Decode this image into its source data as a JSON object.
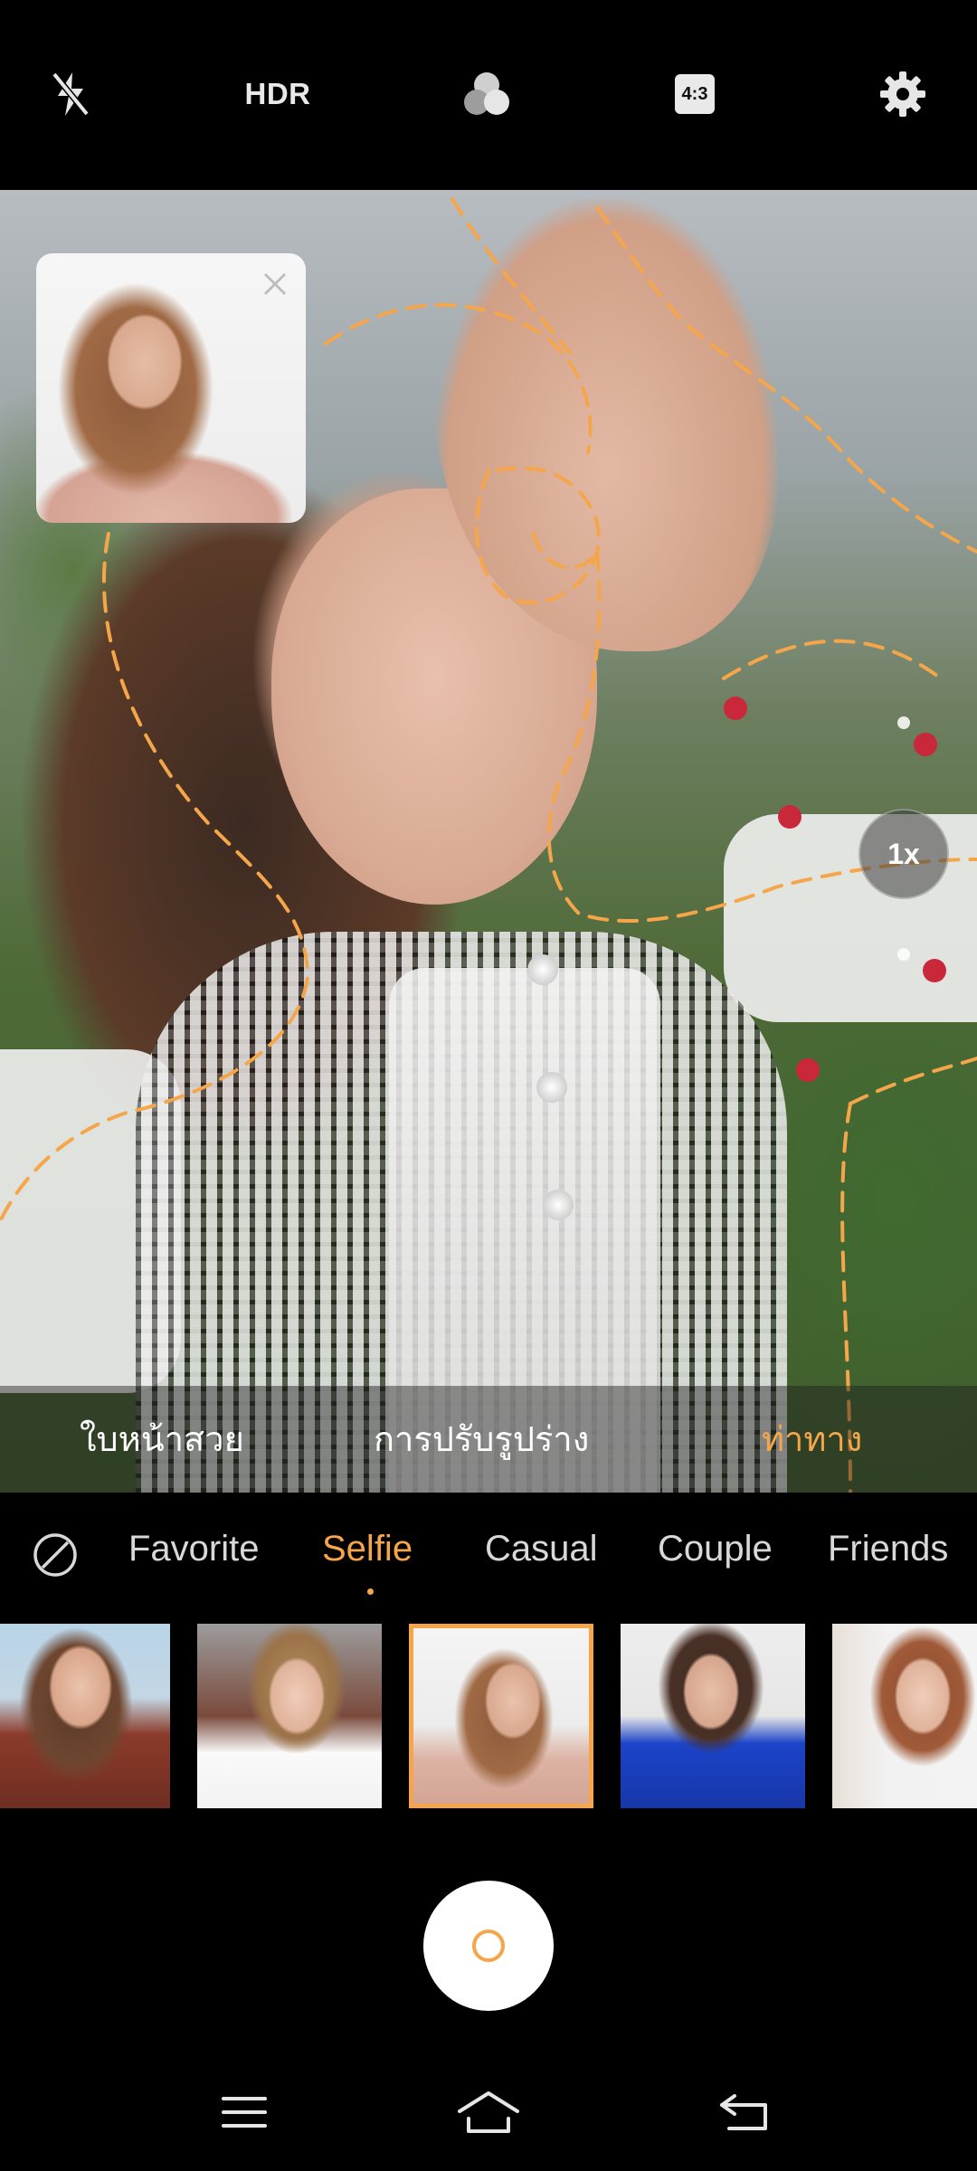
{
  "toolbar": {
    "flash_icon": "flash-off-icon",
    "hdr_label": "HDR",
    "filter_icon": "filters-icon",
    "ratio_label": "4:3",
    "settings_icon": "gear-icon"
  },
  "viewfinder": {
    "zoom_label": "1x",
    "pose_reference_close_icon": "close-icon",
    "options": [
      {
        "label": "ใบหน้าสวย",
        "active": false
      },
      {
        "label": "การปรับรูปร่าง",
        "active": false
      },
      {
        "label": "ท่าทาง",
        "active": true
      }
    ]
  },
  "pose_tabs": {
    "none_icon": "none-icon",
    "items": [
      {
        "label": "Favorite",
        "active": false
      },
      {
        "label": "Selfie",
        "active": true
      },
      {
        "label": "Casual",
        "active": false
      },
      {
        "label": "Couple",
        "active": false
      },
      {
        "label": "Friends",
        "active": false
      }
    ],
    "selected_thumbnail_index": 2
  },
  "shutter": {
    "icon": "shutter-button"
  },
  "navbar": {
    "menu_icon": "menu-icon",
    "home_icon": "home-icon",
    "back_icon": "back-icon"
  },
  "colors": {
    "accent": "#f5a64a",
    "background": "#000000",
    "text_primary": "#ffffff"
  }
}
